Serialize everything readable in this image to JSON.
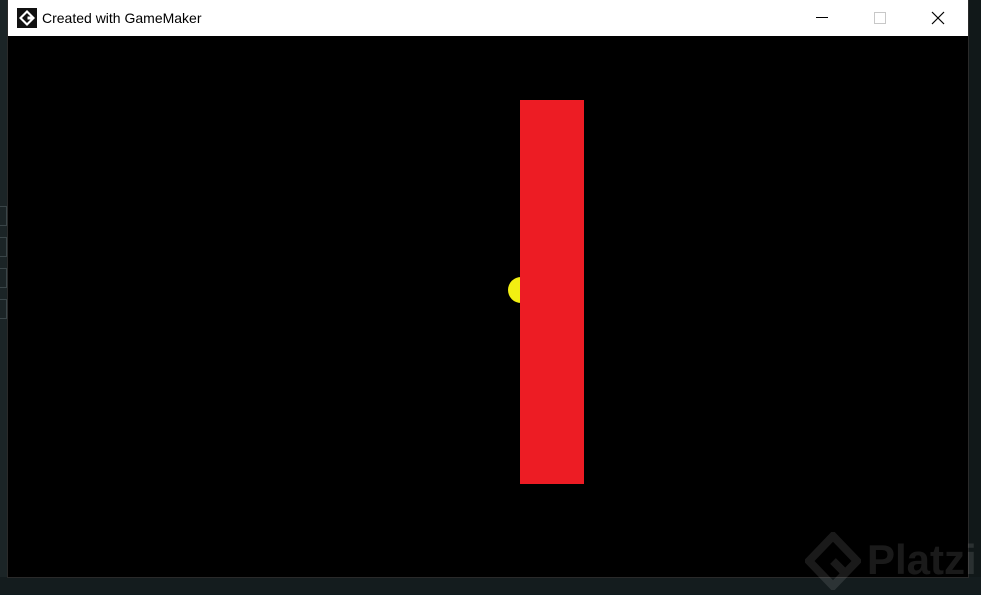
{
  "window": {
    "title": "Created with GameMaker",
    "app_icon": "gamemaker-icon",
    "controls": {
      "minimize_icon": "minimize-icon",
      "maximize_icon": "maximize-icon",
      "close_icon": "close-icon"
    }
  },
  "game": {
    "background_color": "#000000",
    "player": {
      "shape": "circle",
      "color": "#f2ef12"
    },
    "wall": {
      "shape": "rectangle",
      "color": "#ed1c24"
    }
  },
  "watermark": {
    "text": "Platzi",
    "icon": "platzi-logo-icon"
  }
}
